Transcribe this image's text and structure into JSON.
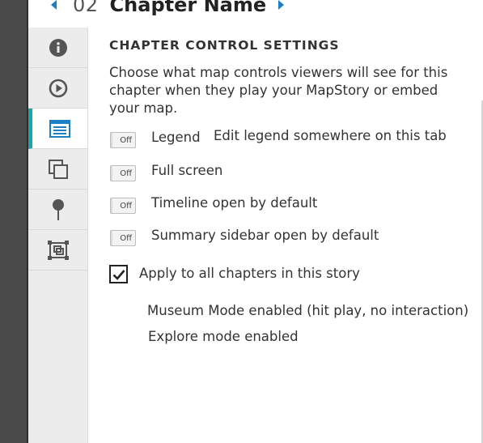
{
  "header": {
    "prev_icon": "caret-left-icon",
    "next_icon": "caret-right-icon",
    "chapter_number": "02",
    "chapter_name": "Chapter Name",
    "accent_color": "#1a7fc4"
  },
  "sidebar": {
    "active_color": "#1aa6a6",
    "tabs": [
      {
        "icon": "info-icon",
        "active": false
      },
      {
        "icon": "play-icon",
        "active": false
      },
      {
        "icon": "list-icon",
        "active": true
      },
      {
        "icon": "layers-icon",
        "active": false
      },
      {
        "icon": "pin-icon",
        "active": false
      },
      {
        "icon": "frame-icon",
        "active": false
      }
    ]
  },
  "settings": {
    "title": "CHAPTER CONTROL SETTINGS",
    "description": "Choose what map controls viewers will see for this chapter when they play your MapStory or embed your map.",
    "options": [
      {
        "toggle_label": "Off",
        "label": "Legend",
        "note": "Edit legend somewhere on this tab"
      },
      {
        "toggle_label": "Off",
        "label": "Full screen"
      },
      {
        "toggle_label": "Off",
        "label": "Timeline open by default"
      },
      {
        "toggle_label": "Off",
        "label": "Summary sidebar open by default"
      }
    ],
    "apply_all": {
      "checked": true,
      "label": "Apply to all chapters in this story"
    },
    "modes": [
      "Museum Mode enabled (hit play, no interaction)",
      "Explore mode enabled"
    ]
  }
}
